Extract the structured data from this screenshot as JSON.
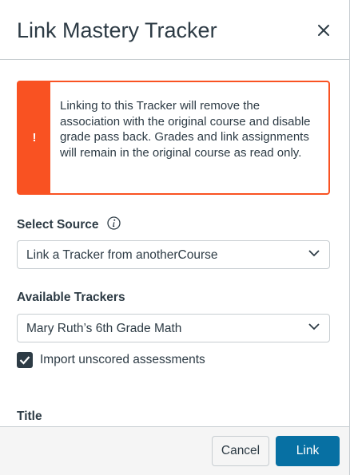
{
  "modal": {
    "title": "Link Mastery Tracker",
    "close_icon": "close-icon"
  },
  "alert": {
    "icon": "!",
    "message": "Linking to this Tracker will remove the association with the original course and disable grade pass back. Grades and link assignments will remain in the original course as read only.",
    "color": "#f95222"
  },
  "source": {
    "label": "Select Source",
    "info_icon": "info-icon",
    "value": "Link a Tracker from anotherCourse"
  },
  "trackers": {
    "label": "Available Trackers",
    "value": "Mary Ruth’s 6th Grade Math"
  },
  "import_unscored": {
    "label": "Import unscored assessments",
    "checked": true
  },
  "title_field": {
    "label": "Title"
  },
  "footer": {
    "cancel_label": "Cancel",
    "link_label": "Link",
    "primary_color": "#0770a3"
  }
}
